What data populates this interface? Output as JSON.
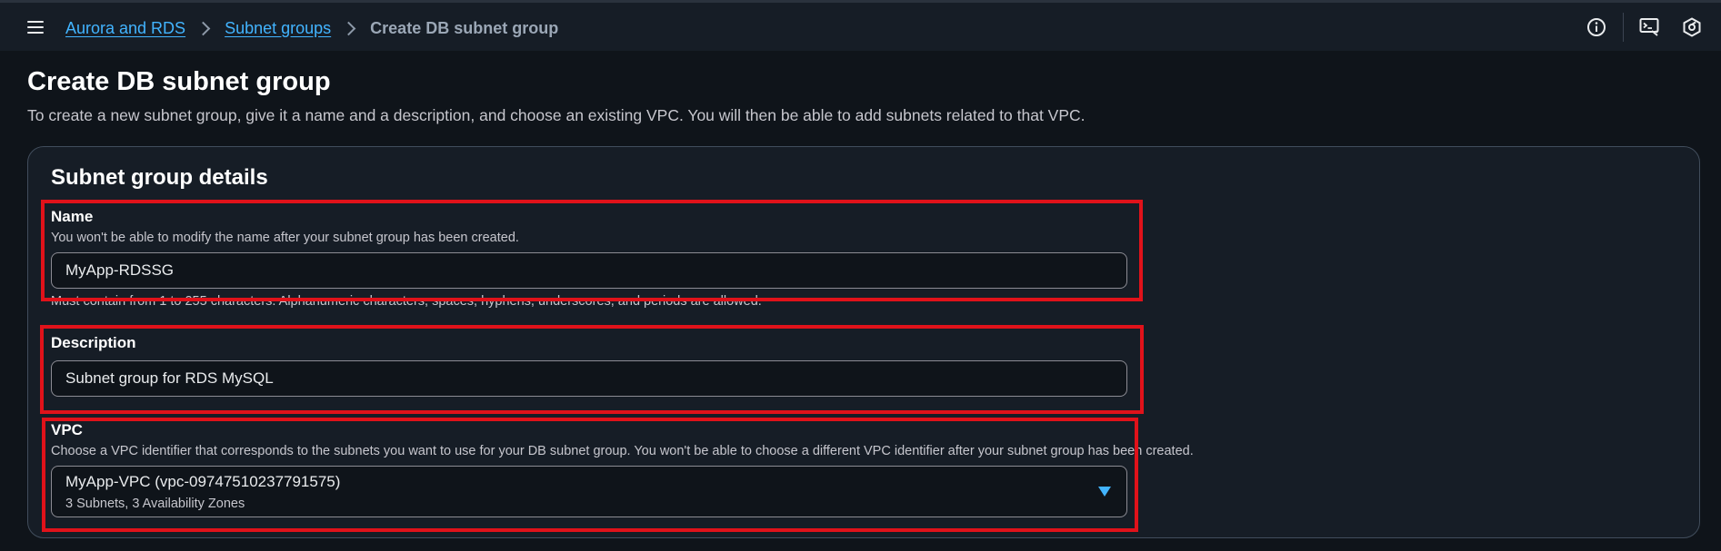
{
  "breadcrumb": {
    "items": [
      "Aurora and RDS",
      "Subnet groups"
    ],
    "current": "Create DB subnet group"
  },
  "icons": {
    "menu": "hamburger-menu-icon",
    "info": "info-icon",
    "cloudshell": "cloudshell-icon",
    "notifications": "settings-hex-icon"
  },
  "page": {
    "title": "Create DB subnet group",
    "description": "To create a new subnet group, give it a name and a description, and choose an existing VPC. You will then be able to add subnets related to that VPC."
  },
  "details": {
    "title": "Subnet group details",
    "name": {
      "label": "Name",
      "description": "You won't be able to modify the name after your subnet group has been created.",
      "value": "MyApp-RDSSG",
      "constraint": "Must contain from 1 to 255 characters. Alphanumeric characters, spaces, hyphens, underscores, and periods are allowed."
    },
    "description": {
      "label": "Description",
      "value": "Subnet group for RDS MySQL"
    },
    "vpc": {
      "label": "VPC",
      "description": "Choose a VPC identifier that corresponds to the subnets you want to use for your DB subnet group. You won't be able to choose a different VPC identifier after your subnet group has been created.",
      "selected": "MyApp-VPC (vpc-09747510237791575)",
      "selected_detail": "3 Subnets, 3 Availability Zones"
    }
  },
  "colors": {
    "background": "#0f141a",
    "link": "#42b4ff",
    "highlight": "#e0121a"
  }
}
